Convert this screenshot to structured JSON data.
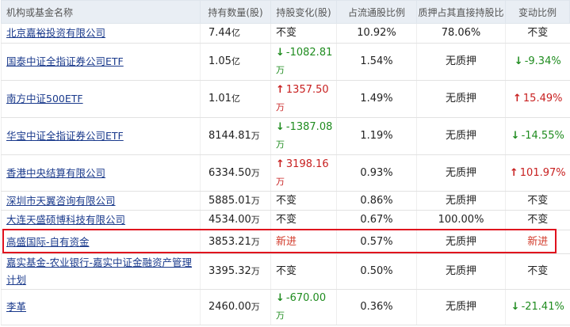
{
  "headers": [
    "机构或基金名称",
    "持有数量(股)",
    "持股变化(股)",
    "占流通股比例",
    "质押占其直接持股比",
    "变动比例"
  ],
  "rows": [
    {
      "name": "北京嘉裕投资有限公司",
      "qty": "7.44",
      "qty_unit": "亿",
      "chg_dir": "none",
      "chg": "不变",
      "chg_unit": "",
      "pct": "10.92%",
      "pledge": "78.06%",
      "ratio_dir": "none",
      "ratio": "不变"
    },
    {
      "name": "国泰中证全指证券公司ETF",
      "qty": "1.05",
      "qty_unit": "亿",
      "chg_dir": "down",
      "chg": "-1082.81",
      "chg_unit": "万",
      "pct": "1.54%",
      "pledge": "无质押",
      "ratio_dir": "down",
      "ratio": "-9.34%"
    },
    {
      "name": "南方中证500ETF",
      "qty": "1.01",
      "qty_unit": "亿",
      "chg_dir": "up",
      "chg": "1357.50",
      "chg_unit": "万",
      "pct": "1.49%",
      "pledge": "无质押",
      "ratio_dir": "up",
      "ratio": "15.49%"
    },
    {
      "name": "华宝中证全指证券公司ETF",
      "qty": "8144.81",
      "qty_unit": "万",
      "chg_dir": "down",
      "chg": "-1387.08",
      "chg_unit": "万",
      "pct": "1.19%",
      "pledge": "无质押",
      "ratio_dir": "down",
      "ratio": "-14.55%"
    },
    {
      "name": "香港中央结算有限公司",
      "qty": "6334.50",
      "qty_unit": "万",
      "chg_dir": "up",
      "chg": "3198.16",
      "chg_unit": "万",
      "pct": "0.93%",
      "pledge": "无质押",
      "ratio_dir": "up",
      "ratio": "101.97%"
    },
    {
      "name": "深圳市天翼咨询有限公司",
      "qty": "5885.01",
      "qty_unit": "万",
      "chg_dir": "none",
      "chg": "不变",
      "chg_unit": "",
      "pct": "0.86%",
      "pledge": "无质押",
      "ratio_dir": "none",
      "ratio": "不变"
    },
    {
      "name": "大连天盛硕博科技有限公司",
      "qty": "4534.00",
      "qty_unit": "万",
      "chg_dir": "none",
      "chg": "不变",
      "chg_unit": "",
      "pct": "0.67%",
      "pledge": "100.00%",
      "ratio_dir": "none",
      "ratio": "不变"
    },
    {
      "name": "高盛国际-自有资金",
      "qty": "3853.21",
      "qty_unit": "万",
      "chg_dir": "new",
      "chg": "新进",
      "chg_unit": "",
      "pct": "0.57%",
      "pledge": "无质押",
      "ratio_dir": "new",
      "ratio": "新进"
    },
    {
      "name": "嘉实基金-农业银行-嘉实中证金融资产管理计划",
      "qty": "3395.32",
      "qty_unit": "万",
      "chg_dir": "none",
      "chg": "不变",
      "chg_unit": "",
      "pct": "0.50%",
      "pledge": "无质押",
      "ratio_dir": "none",
      "ratio": "不变"
    },
    {
      "name": "李革",
      "qty": "2460.00",
      "qty_unit": "万",
      "chg_dir": "down",
      "chg": "-670.00",
      "chg_unit": "万",
      "pct": "0.36%",
      "pledge": "无质押",
      "ratio_dir": "down",
      "ratio": "-21.41%"
    }
  ],
  "colors": {
    "up": "#c82020",
    "down": "#1f8c1f",
    "new": "#d23a2a",
    "highlight": "#e0111e",
    "link": "#1a3a8c",
    "header_bg": "#e9eef4"
  },
  "icons": {
    "up": "arrow-up-icon",
    "down": "arrow-down-icon"
  }
}
